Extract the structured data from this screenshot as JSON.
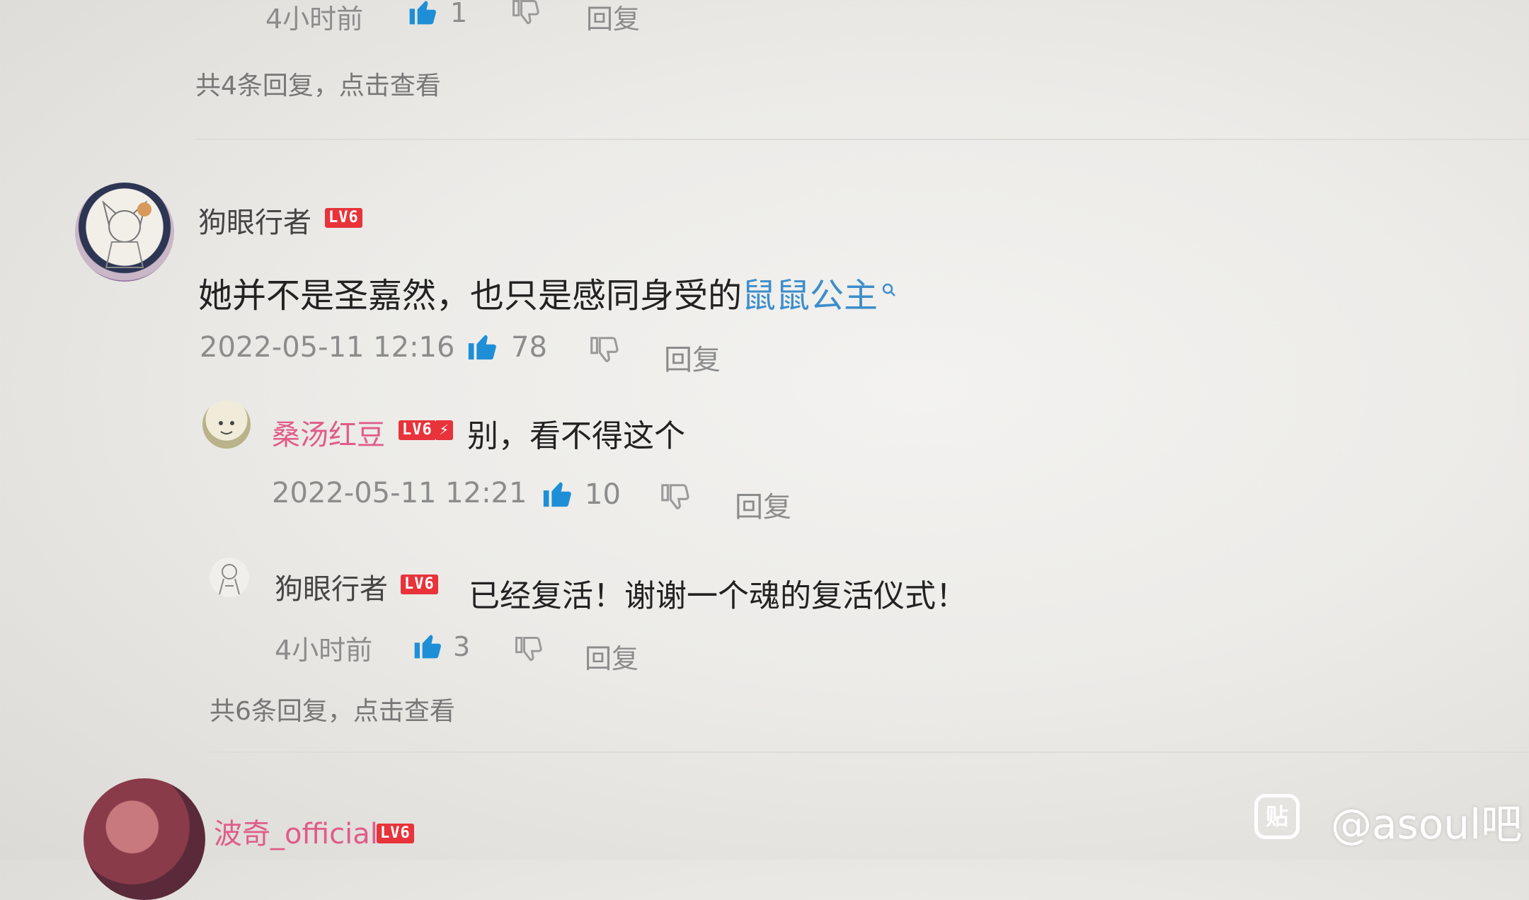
{
  "top_reply": {
    "time": "4小时前",
    "likes": "1",
    "reply_label": "回复",
    "more": "共4条回复，点击查看"
  },
  "comment": {
    "username": "狗眼行者",
    "level": "LV6",
    "text": "她并不是圣嘉然，也只是感同身受的",
    "link_text": "鼠鼠公主",
    "time": "2022-05-11 12:16",
    "likes": "78",
    "reply_label": "回复"
  },
  "reply1": {
    "username": "桑汤红豆",
    "level": "LV6",
    "text": "别，看不得这个",
    "time": "2022-05-11 12:21",
    "likes": "10",
    "reply_label": "回复"
  },
  "reply2": {
    "username": "狗眼行者",
    "level": "LV6",
    "text": "已经复活！谢谢一个魂的复活仪式！",
    "time": "4小时前",
    "likes": "3",
    "reply_label": "回复"
  },
  "comment_more": "共6条回复，点击查看",
  "next_comment": {
    "username": "波奇_official",
    "level": "LV6"
  },
  "watermark": {
    "icon_char": "贴",
    "text": "@asoul吧"
  },
  "colors": {
    "like_blue": "#1e8fd6",
    "link_blue": "#3d8ecb",
    "level_red": "#e8333a",
    "pink_name": "#e05c8a"
  },
  "icons": [
    "thumbs-up-icon",
    "thumbs-down-icon",
    "search-icon",
    "tieba-logo-icon"
  ]
}
